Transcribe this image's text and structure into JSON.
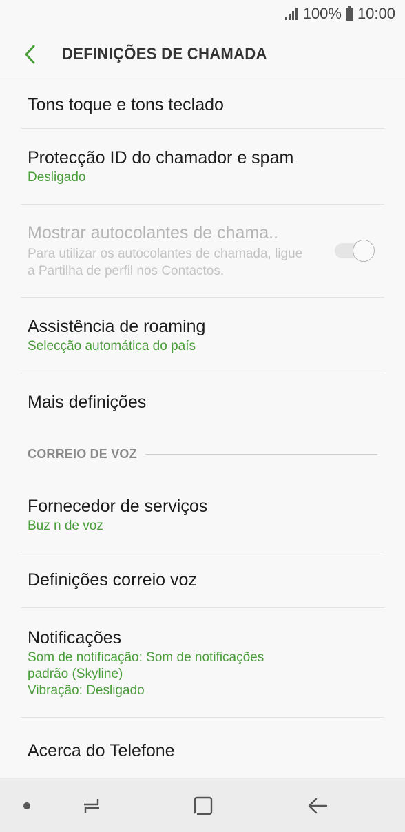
{
  "status_bar": {
    "battery": "100%",
    "time": "10:00"
  },
  "header": {
    "title": "DEFINIÇÕES DE CHAMADA"
  },
  "items": {
    "ringtones": {
      "title": "Tons toque e tons teclado"
    },
    "caller_id": {
      "title": "Protecção ID do chamador e spam",
      "sub": "Desligado"
    },
    "stickers": {
      "title": "Mostrar autocolantes de chama..",
      "desc": "Para utilizar os autocolantes de chamada, ligue a Partilha de perfil nos Contactos.",
      "toggle_state": "off"
    },
    "roaming": {
      "title": "Assistência de roaming",
      "sub": "Selecção automática do país"
    },
    "more": {
      "title": "Mais definições"
    }
  },
  "voicemail_section": {
    "label": "CORREIO DE VOZ",
    "provider": {
      "title": "Fornecedor de serviços",
      "sub": "Buz n de voz"
    },
    "settings": {
      "title": "Definições correio voz"
    },
    "notifications": {
      "title": "Notificações",
      "sub_line1": "Som de notificação: Som de notificações",
      "sub_line2": "padrão (Skyline)",
      "sub_line3": "Vibração: Desligado"
    }
  },
  "about": {
    "title": "Acerca do Telefone"
  },
  "colors": {
    "accent": "#4a9e3a",
    "disabled": "#b5b5b5"
  },
  "icons": {
    "back": "back-arrow-icon",
    "nav_recents": "recents-icon",
    "nav_home": "home-icon",
    "nav_back": "back-icon"
  }
}
